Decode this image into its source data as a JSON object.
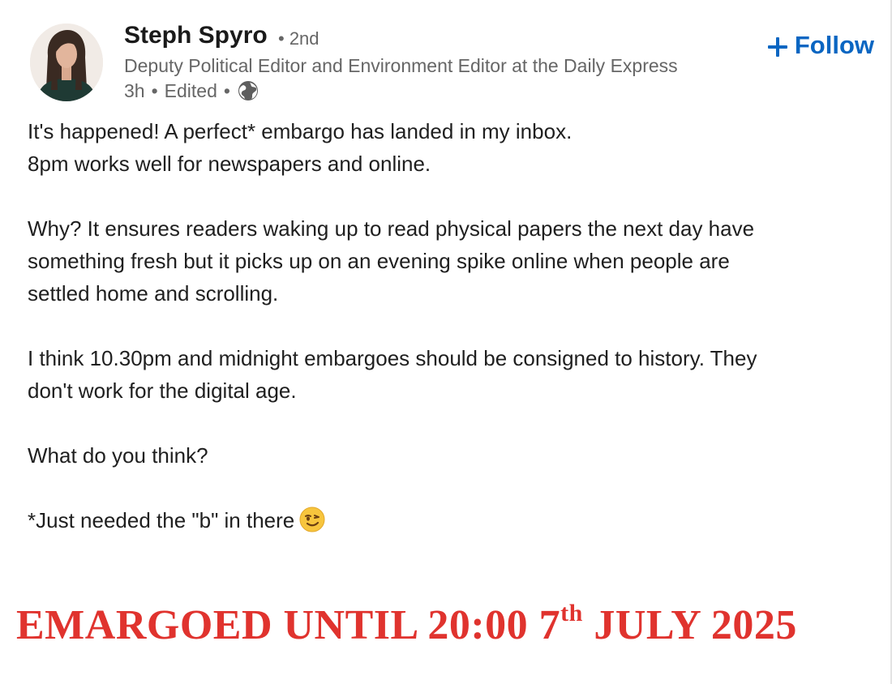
{
  "author": {
    "name": "Steph Spyro",
    "degree": "• 2nd",
    "headline": "Deputy Political Editor and Environment Editor at the Daily Express",
    "time": "3h",
    "separator": "•",
    "edited": "Edited",
    "visibility_icon": "globe-icon"
  },
  "follow": {
    "label": "Follow",
    "icon": "plus-icon",
    "color": "#0a66c2"
  },
  "post": {
    "lines": [
      "It's happened! A perfect* embargo has landed in my inbox.",
      "8pm works well for newspapers and online.",
      "Why? It ensures readers waking up to read physical papers the next day have",
      "something fresh but it picks up on an evening spike online when people are",
      "settled home and scrolling.",
      "I think 10.30pm and midnight embargoes should be consigned to history. They",
      "don't work for the digital age.",
      "What do you think?",
      "*Just needed the \"b\" in there"
    ],
    "emoji": "winking-face-emoji"
  },
  "image": {
    "text_before": "EMARGOED UNTIL 20:00 7",
    "superscript": "th",
    "text_after": " JULY 2025",
    "color": "#e0332e"
  }
}
